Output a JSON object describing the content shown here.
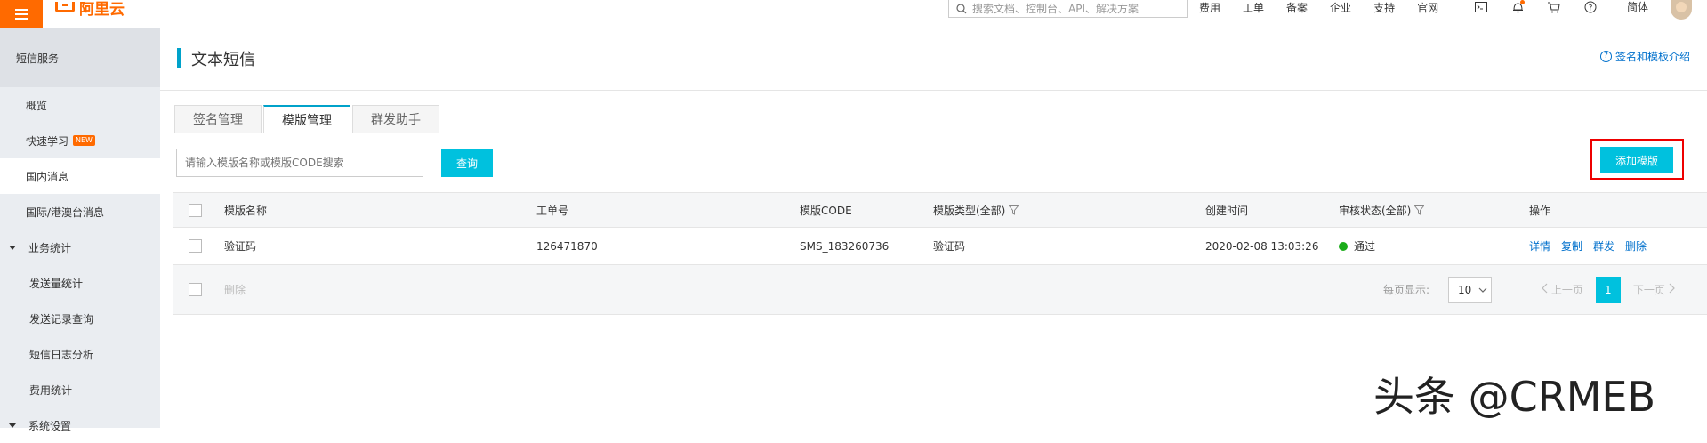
{
  "topbar": {
    "logo_text": "阿里云",
    "search_placeholder": "搜索文档、控制台、API、解决方案",
    "nav_links": [
      "费用",
      "工单",
      "备案",
      "企业",
      "支持",
      "官网"
    ],
    "lang": "简体",
    "accent": "#ff6a00"
  },
  "sidebar": {
    "title": "短信服务",
    "items": [
      {
        "label": "概览"
      },
      {
        "label": "快速学习",
        "badge": "NEW"
      },
      {
        "label": "国内消息"
      },
      {
        "label": "国际/港澳台消息"
      },
      {
        "label": "业务统计"
      },
      {
        "label": "发送量统计"
      },
      {
        "label": "发送记录查询"
      },
      {
        "label": "短信日志分析"
      },
      {
        "label": "费用统计"
      },
      {
        "label": "系统设置"
      }
    ]
  },
  "page": {
    "title": "文本短信",
    "help_link": "签名和模板介绍"
  },
  "tabs": [
    "签名管理",
    "模版管理",
    "群发助手"
  ],
  "toolbar": {
    "search_placeholder": "请输入模版名称或模版CODE搜索",
    "query_label": "查询",
    "add_label": "添加模版"
  },
  "table": {
    "headers": [
      "模版名称",
      "工单号",
      "模版CODE",
      "模版类型(全部)",
      "创建时间",
      "审核状态(全部)",
      "操作"
    ],
    "rows": [
      {
        "name": "验证码",
        "ticket": "126471870",
        "code": "SMS_183260736",
        "type": "验证码",
        "created": "2020-02-08 13:03:26",
        "status": "通过",
        "actions": [
          "详情",
          "复制",
          "群发",
          "删除"
        ]
      }
    ],
    "footer": {
      "delete_label": "删除",
      "per_page_label": "每页显示:",
      "per_page_value": "10",
      "prev_label": "上一页",
      "next_label": "下一页",
      "current_page": "1"
    }
  },
  "watermark": "头条 @CRMEB",
  "colors": {
    "primary_button": "#00c1de",
    "link": "#0070cc",
    "status_pass": "#1aac19",
    "highlight_border": "#ee0000"
  }
}
